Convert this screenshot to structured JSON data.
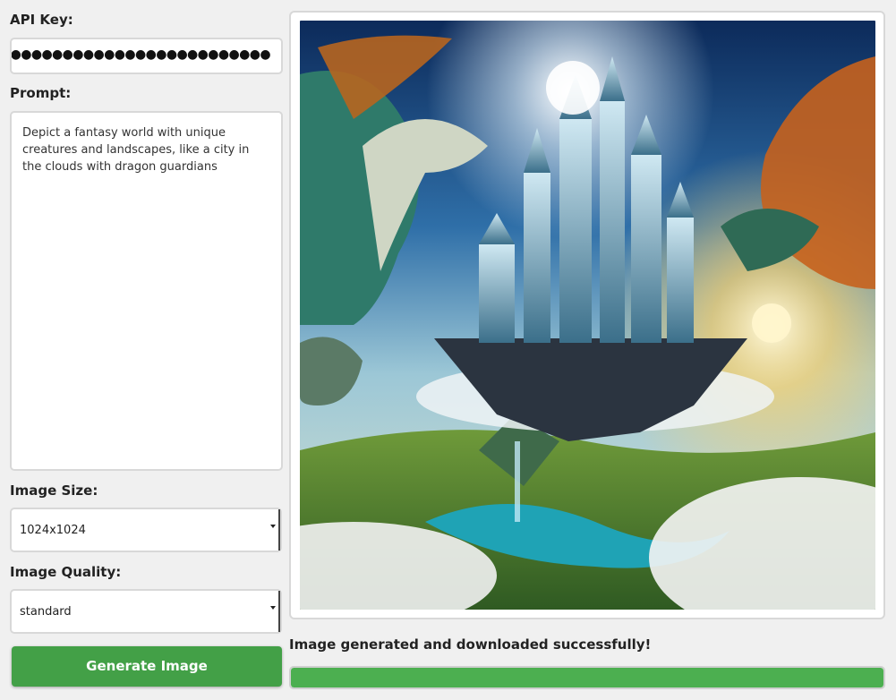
{
  "form": {
    "api_key_label": "API Key:",
    "api_key_value": "●●●●●●●●●●●●●●●●●●●●●●●●●●●●●●●●●●●●●●●",
    "prompt_label": "Prompt:",
    "prompt_value": "Depict a fantasy world with unique creatures and landscapes, like a city in the clouds with dragon guardians",
    "size_label": "Image Size:",
    "size_value": "1024x1024",
    "quality_label": "Image Quality:",
    "quality_value": "standard",
    "generate_label": "Generate Image"
  },
  "output": {
    "status_text": "Image generated and downloaded successfully!",
    "progress": 1.0
  },
  "colors": {
    "button": "#43a047",
    "progress": "#4caf50"
  }
}
